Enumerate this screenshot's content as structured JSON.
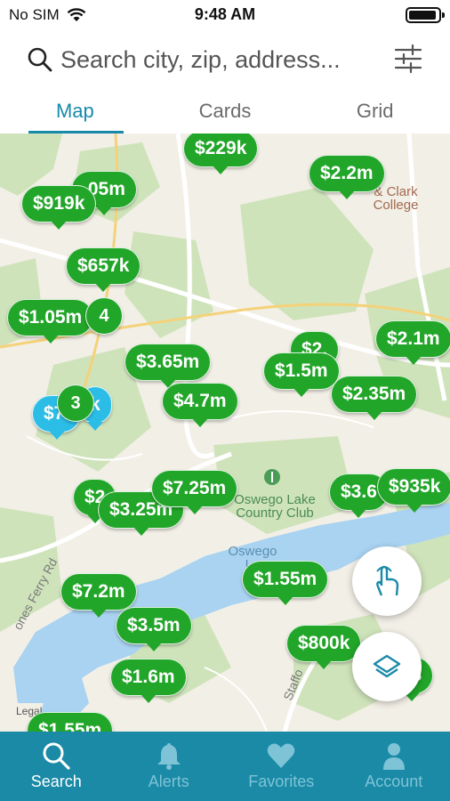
{
  "status_bar": {
    "carrier": "No SIM",
    "time": "9:48 AM"
  },
  "search": {
    "placeholder": "Search city, zip, address..."
  },
  "tabs": [
    {
      "label": "Map",
      "active": true
    },
    {
      "label": "Cards",
      "active": false
    },
    {
      "label": "Grid",
      "active": false
    }
  ],
  "map": {
    "labels": {
      "college": "& Clark\nCollege",
      "club": "Oswego Lake\nCountry Club",
      "lake": "Oswego\nLa",
      "road1": "ones Ferry Rd",
      "road2": "Staffo",
      "legal": "Legal"
    },
    "clusters": [
      "4",
      "3"
    ],
    "prices": [
      "$229k",
      "$2.2m",
      "$919k",
      ".05m",
      "$657k",
      "$1.05m",
      "$2.1m",
      "$1.5m",
      "$3.65m",
      "$4.7m",
      "$2.35m",
      "$3.6",
      "$935k",
      "$7.25m",
      "$3.25m",
      "$7.2m",
      "$1.55m",
      "$3.5m",
      "$800k",
      "$1.6m",
      "$2.",
      "$7.",
      "$2",
      "$3",
      "k",
      "$1.55m"
    ],
    "colors": {
      "listing": "#22a629",
      "selected": "#2bbde6"
    }
  },
  "bottom_nav": [
    {
      "label": "Search",
      "icon": "search-icon",
      "active": true
    },
    {
      "label": "Alerts",
      "icon": "bell-icon",
      "active": false
    },
    {
      "label": "Favorites",
      "icon": "heart-icon",
      "active": false
    },
    {
      "label": "Account",
      "icon": "person-icon",
      "active": false
    }
  ],
  "colors": {
    "accent": "#178aaa",
    "nav_bg": "#1a8aa7"
  }
}
